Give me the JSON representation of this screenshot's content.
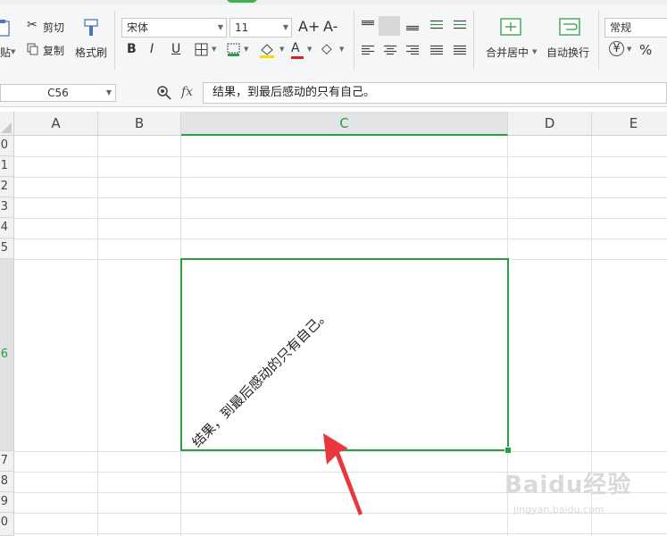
{
  "ribbon": {
    "paste_label": "贴",
    "cut_label": "剪切",
    "copy_label": "复制",
    "format_painter_label": "格式刷",
    "font_name": "宋体",
    "font_size": "11",
    "merge_center_label": "合并居中",
    "wrap_text_label": "自动换行",
    "number_format": "常规",
    "currency_symbol": "¥",
    "percent_symbol": "%",
    "font_increase": "A+",
    "font_decrease": "A-",
    "bold": "B",
    "italic": "I",
    "underline": "U",
    "font_color_glyph": "A"
  },
  "formula_bar": {
    "cell_ref": "C56",
    "fx_label": "fx",
    "formula": "结果，到最后感动的只有自己。"
  },
  "grid": {
    "columns": [
      "A",
      "B",
      "C",
      "D",
      "E"
    ],
    "selected_column": "C",
    "rows": [
      "0",
      "1",
      "2",
      "3",
      "4",
      "5",
      "6",
      "7",
      "8",
      "9",
      "0"
    ],
    "selected_row": "6"
  },
  "cell": {
    "text": "结果，到最后感动的只有自己。",
    "rotation": "-45deg"
  },
  "watermark": {
    "text": "Baidu经验",
    "url": "jingyan.baidu.com"
  },
  "colors": {
    "accent": "#2e9d42",
    "arrow": "#e8383d"
  }
}
